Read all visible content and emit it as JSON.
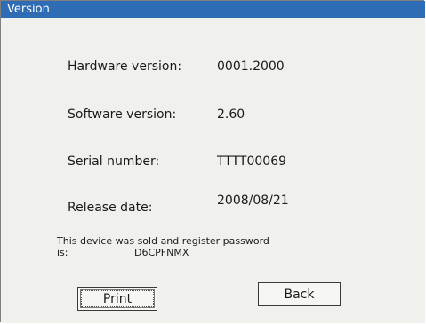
{
  "window": {
    "title": "Version"
  },
  "info": {
    "hardware": {
      "label": "Hardware version:",
      "value": "0001.2000"
    },
    "software": {
      "label": "Software version:",
      "value": "2.60"
    },
    "serial": {
      "label": "Serial number:",
      "value": "TTTT00069"
    },
    "release": {
      "label": "Release date:",
      "value": "2008/08/21"
    }
  },
  "notice": {
    "line1": "This device was sold and register password is:",
    "password": "D6CPFNMX"
  },
  "buttons": {
    "print": "Print",
    "back": "Back"
  }
}
